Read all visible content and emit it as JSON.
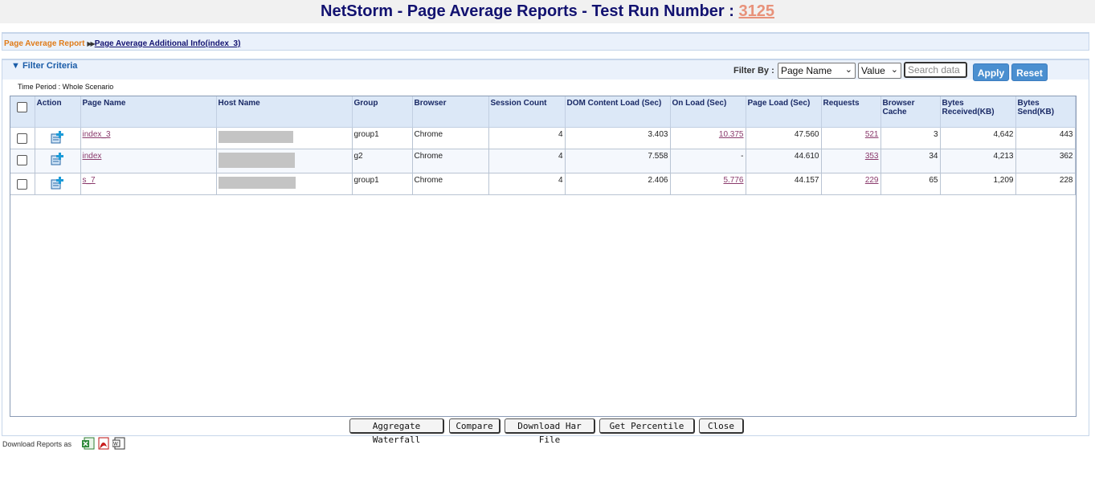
{
  "header": {
    "title_prefix": "NetStorm - Page Average Reports - Test Run Number :",
    "run_number": "3125"
  },
  "breadcrumb": {
    "current": "Page Average Report",
    "arrows": "▶▶",
    "link": "Page Average Additional Info(index_3)"
  },
  "filter": {
    "title": "Filter Criteria",
    "filter_by_label": "Filter By :",
    "field_select": "Page Name",
    "value_select": "Value",
    "search_placeholder": "Search data",
    "apply_label": "Apply",
    "reset_label": "Reset"
  },
  "time_period": "Time Period : Whole Scenario",
  "table": {
    "columns": [
      "Action",
      "Page Name",
      "Host Name",
      "Group",
      "Browser",
      "Session Count",
      "DOM Content Load (Sec)",
      "On Load (Sec)",
      "Page Load (Sec)",
      "Requests",
      "Browser Cache",
      "Bytes Received(KB)",
      "Bytes Send(KB)"
    ],
    "rows": [
      {
        "page_name": "index_3",
        "group": "group1",
        "browser": "Chrome",
        "session_count": "4",
        "dom_load": "3.403",
        "on_load": "10.375",
        "page_load": "47.560",
        "requests": "521",
        "browser_cache": "3",
        "bytes_received": "4,642",
        "bytes_send": "443"
      },
      {
        "page_name": "index",
        "group": "g2",
        "browser": "Chrome",
        "session_count": "4",
        "dom_load": "7.558",
        "on_load": "-",
        "page_load": "44.610",
        "requests": "353",
        "browser_cache": "34",
        "bytes_received": "4,213",
        "bytes_send": "362"
      },
      {
        "page_name": "s_7",
        "group": "group1",
        "browser": "Chrome",
        "session_count": "4",
        "dom_load": "2.406",
        "on_load": "5.776",
        "page_load": "44.157",
        "requests": "229",
        "browser_cache": "65",
        "bytes_received": "1,209",
        "bytes_send": "228"
      }
    ]
  },
  "buttons": {
    "aggregate_waterfall": "Aggregate Waterfall",
    "compare": "Compare",
    "download_har": "Download Har File",
    "get_percentile": "Get Percentile",
    "close": "Close"
  },
  "download": {
    "label": "Download Reports as",
    "icons": [
      "excel-icon",
      "pdf-icon",
      "word-icon"
    ]
  },
  "colors": {
    "title": "#121270",
    "run_link": "#e8927a",
    "breadcrumb_current": "#e07b18",
    "apply_button": "#4a8fd0",
    "row_link": "#8a3a6c"
  }
}
